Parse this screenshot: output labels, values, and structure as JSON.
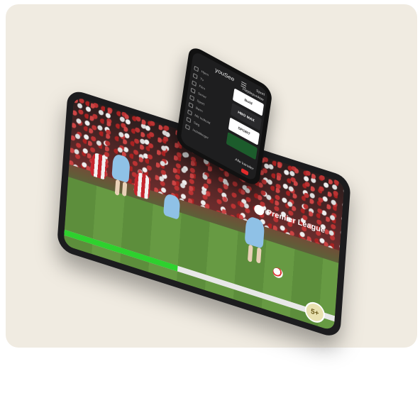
{
  "tablet": {
    "league_name": "Premier League",
    "badge_text": "5+",
    "progress": 0.42,
    "colors": {
      "progress_fill": "#2ed12e",
      "progress_track": "#e8e8e8"
    }
  },
  "phone": {
    "brand": "youSee",
    "header_tag_1": "Sport",
    "header_tag_2": "Højdepunkter",
    "menu_items": [
      "Hjem",
      "Tv",
      "Film",
      "Serier",
      "Sport",
      "Børn",
      "Mit Indhold",
      "Søg",
      "Indstillinger"
    ],
    "tiles": [
      "Bold",
      "HBO MAX",
      "SPORT",
      ""
    ],
    "cta": "Alle kanaler"
  }
}
